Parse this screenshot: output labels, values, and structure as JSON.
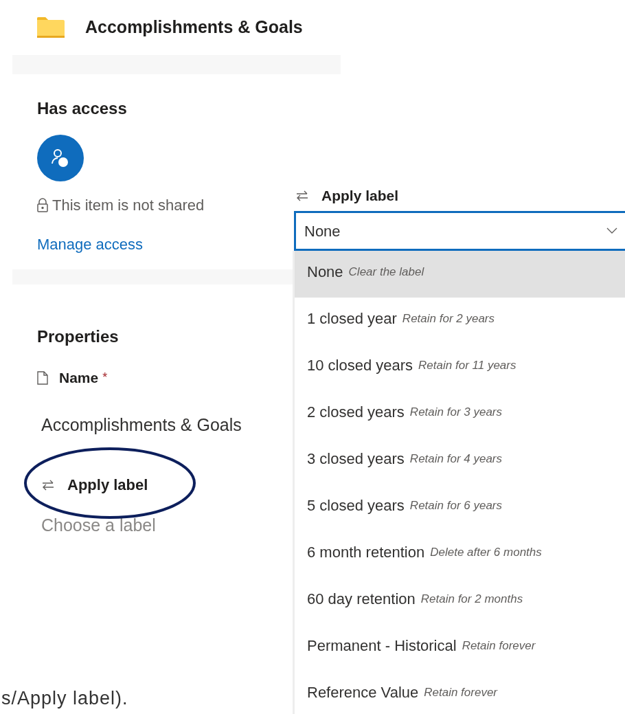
{
  "header": {
    "title": "Accomplishments & Goals"
  },
  "access": {
    "heading": "Has access",
    "status": "This item is not shared",
    "link": "Manage access"
  },
  "properties": {
    "heading": "Properties",
    "name_label": "Name",
    "required_mark": "*",
    "name_value": "Accomplishments & Goals",
    "label_heading": "Apply label",
    "label_circled": true,
    "label_placeholder": "Choose a label"
  },
  "dropdown": {
    "label": "Apply label",
    "value": "None",
    "options": [
      {
        "name": "None",
        "description": "Clear the label",
        "selected": true
      },
      {
        "name": "1 closed year",
        "description": "Retain for 2 years",
        "selected": false
      },
      {
        "name": "10 closed years",
        "description": "Retain for 11 years",
        "selected": false
      },
      {
        "name": "2 closed years",
        "description": "Retain for 3 years",
        "selected": false
      },
      {
        "name": "3 closed years",
        "description": "Retain for 4 years",
        "selected": false
      },
      {
        "name": "5 closed years",
        "description": "Retain for 6 years",
        "selected": false
      },
      {
        "name": "6 month retention",
        "description": "Delete after 6 months",
        "selected": false
      },
      {
        "name": "60 day retention",
        "description": "Retain for 2 months",
        "selected": false
      },
      {
        "name": "Permanent - Historical",
        "description": "Retain forever",
        "selected": false
      },
      {
        "name": "Reference Value",
        "description": "Retain forever",
        "selected": false
      }
    ]
  },
  "caption": "s/Apply label)."
}
